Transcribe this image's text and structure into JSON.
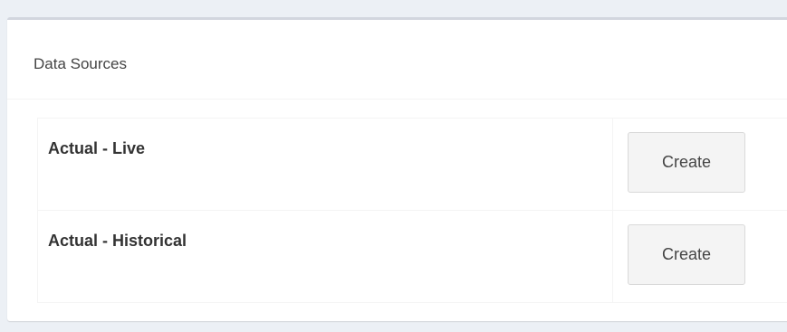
{
  "panel": {
    "title": "Data Sources"
  },
  "sources": [
    {
      "name": "Actual - Live",
      "action_label": "Create"
    },
    {
      "name": "Actual - Historical",
      "action_label": "Create"
    }
  ],
  "colors": {
    "page_background": "#ecf0f5",
    "panel_border_top": "#d2d6de",
    "button_background": "#f4f4f4",
    "button_border": "#d9d9d9"
  }
}
